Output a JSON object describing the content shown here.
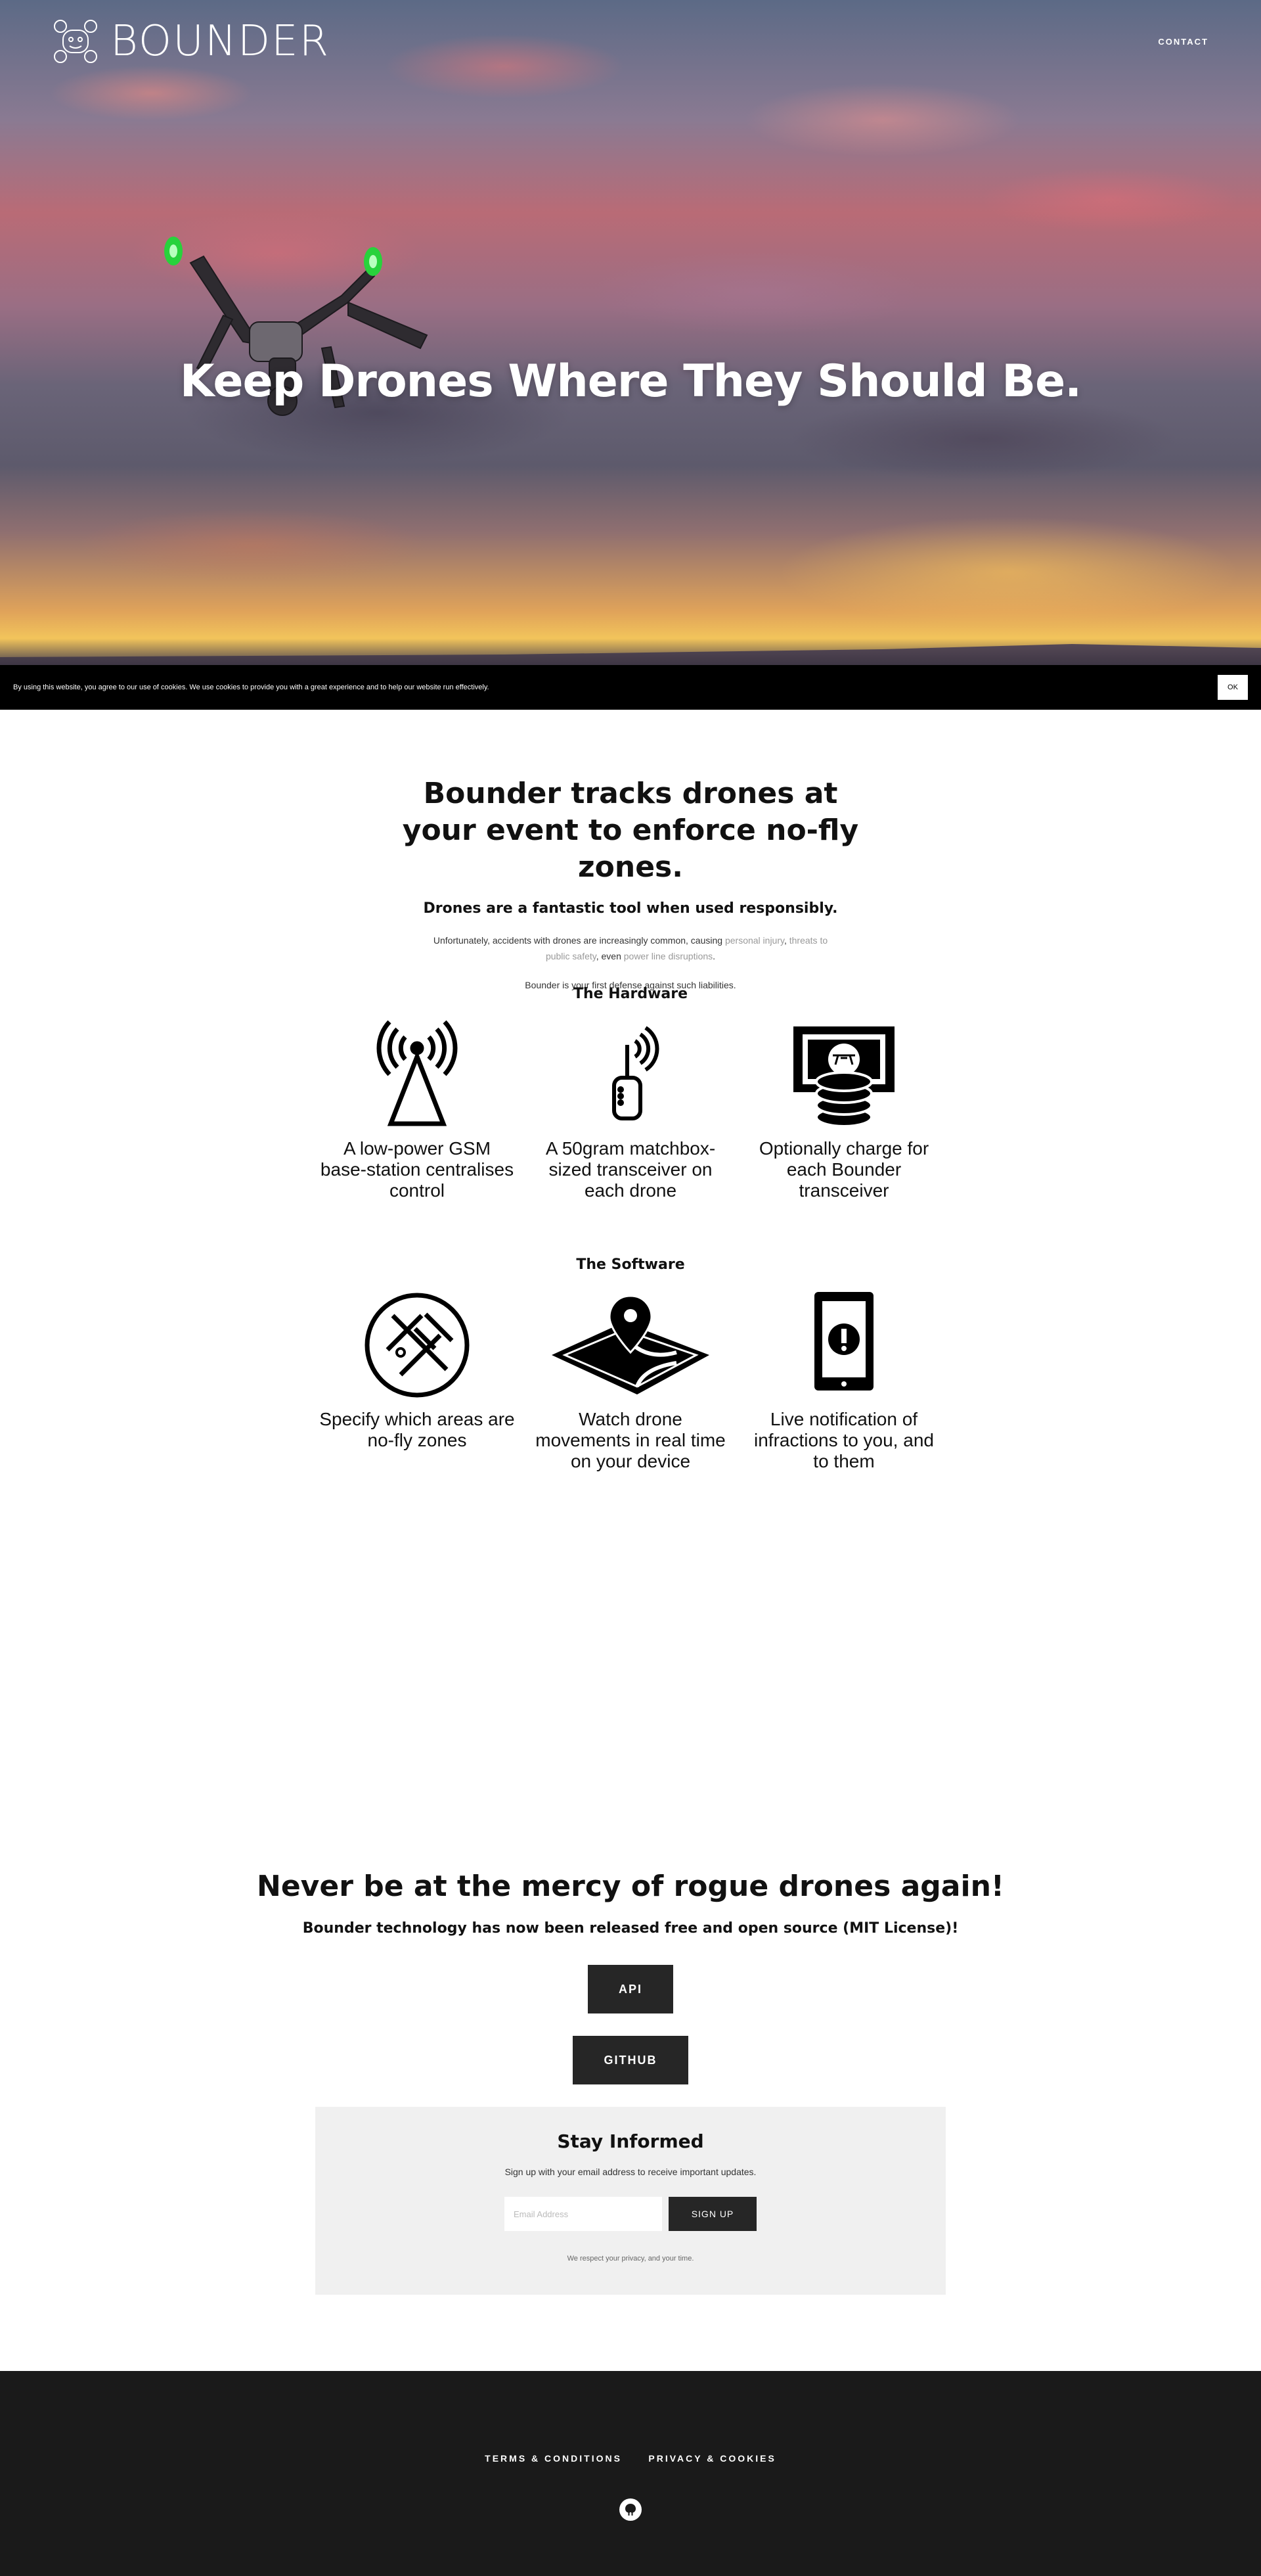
{
  "brand": {
    "name": "BOUNDER"
  },
  "nav": {
    "contact": "CONTACT"
  },
  "hero": {
    "title": "Keep Drones Where They Should Be."
  },
  "cookie_bar": {
    "text": "By using this website, you agree to our use of cookies. We use cookies to provide you with a great experience and to help our website run effectively.",
    "ok_label": "OK"
  },
  "intro": {
    "heading": "Bounder tracks drones at your event to enforce no-fly zones.",
    "subheading": "Drones are a fantastic tool when used responsibly.",
    "p1_prefix": "Unfortunately, accidents with drones are increasingly common, causing ",
    "p1_link1": "personal injury",
    "p1_sep1": ", ",
    "p1_link2": "threats to public safety",
    "p1_sep2": ", even ",
    "p1_link3": "power line disruptions",
    "p1_end": ".",
    "p2": "Bounder is your first defense against such liabilities."
  },
  "hardware": {
    "heading": "The Hardware",
    "items": [
      {
        "icon": "antenna-tower-icon",
        "label": "A low-power GSM base-station centralises control"
      },
      {
        "icon": "transceiver-icon",
        "label": "A 50gram matchbox-sized transceiver on each drone"
      },
      {
        "icon": "money-drone-icon",
        "label": "Optionally charge for each Bounder transceiver"
      }
    ]
  },
  "software": {
    "heading": "The Software",
    "items": [
      {
        "icon": "no-fly-zone-icon",
        "label": "Specify which areas are no-fly zones"
      },
      {
        "icon": "map-pin-icon",
        "label": "Watch drone movements in real time on your device"
      },
      {
        "icon": "tablet-alert-icon",
        "label": "Live notification of infractions to you, and to them"
      }
    ]
  },
  "cta": {
    "heading": "Never be at the mercy of rogue drones again!",
    "subheading": "Bounder technology has now been released free and open source (MIT License)!",
    "api_label": "API",
    "github_label": "GITHUB"
  },
  "newsletter": {
    "heading": "Stay Informed",
    "subtext": "Sign up with your email address to receive important updates.",
    "email_placeholder": "Email Address",
    "signup_label": "SIGN UP",
    "privacy_note": "We respect your privacy, and your time."
  },
  "footer": {
    "terms": "TERMS & CONDITIONS",
    "privacy": "PRIVACY & COOKIES"
  }
}
